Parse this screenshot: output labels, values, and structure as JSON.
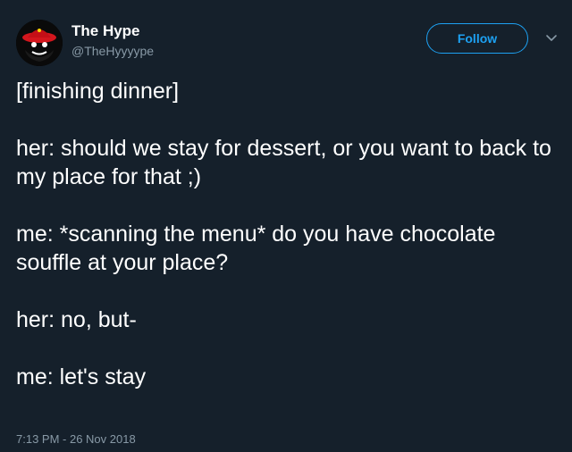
{
  "tweet": {
    "author": {
      "display_name": "The Hype",
      "handle": "@TheHyyyype"
    },
    "follow_label": "Follow",
    "lines": [
      "[finishing dinner]",
      "her: should we stay for dessert, or you want to back to my place for that ;)",
      "me: *scanning the menu* do you have chocolate souffle at your place?",
      "her: no, but-",
      "me: let's stay"
    ],
    "timestamp": "7:13 PM - 26 Nov 2018"
  },
  "colors": {
    "background": "#15202b",
    "text": "#ffffff",
    "secondary_text": "#8899a6",
    "accent": "#1da1f2"
  },
  "icons": {
    "avatar": "avatar-icon",
    "caret": "chevron-down-icon"
  }
}
